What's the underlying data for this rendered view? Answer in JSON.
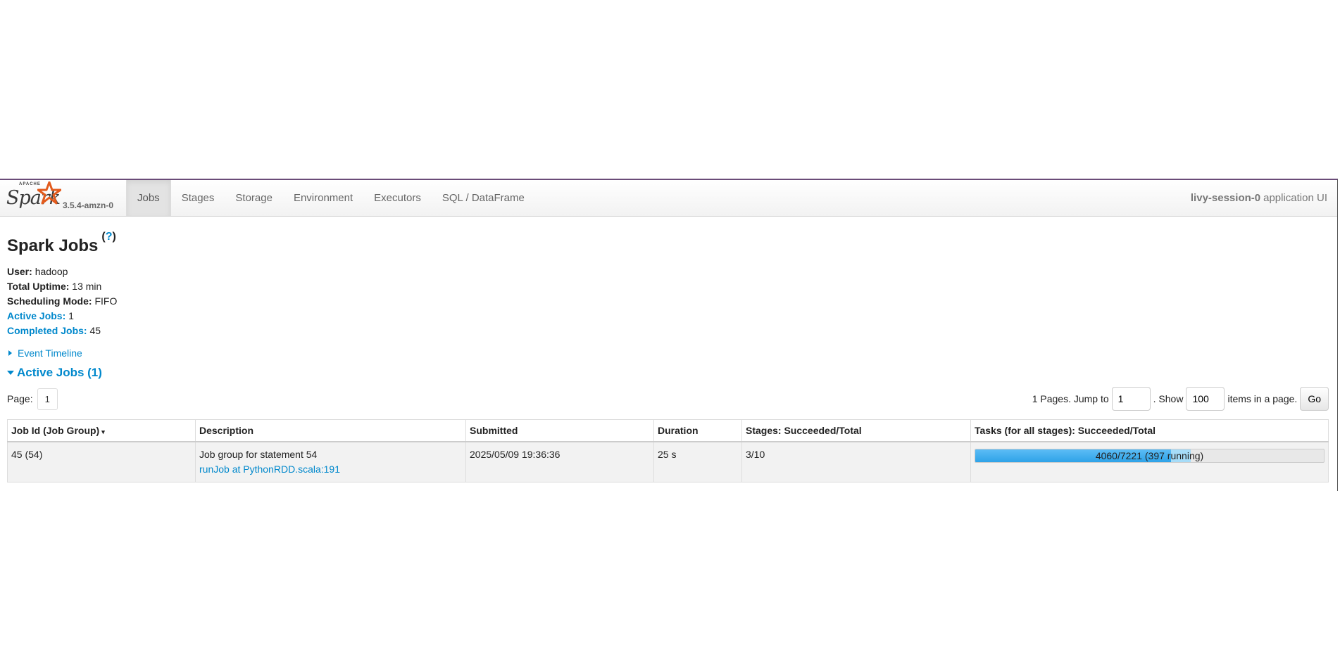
{
  "navbar": {
    "logo_apache": "APACHE",
    "logo_word": "Spark",
    "version": "3.5.4-amzn-0",
    "tabs": [
      {
        "label": "Jobs",
        "active": true
      },
      {
        "label": "Stages"
      },
      {
        "label": "Storage"
      },
      {
        "label": "Environment"
      },
      {
        "label": "Executors"
      },
      {
        "label": "SQL / DataFrame"
      }
    ],
    "app_name": "livy-session-0",
    "app_suffix": "application UI"
  },
  "page": {
    "title": "Spark Jobs",
    "help": "?"
  },
  "summary": {
    "user_label": "User:",
    "user_value": "hadoop",
    "uptime_label": "Total Uptime:",
    "uptime_value": "13 min",
    "mode_label": "Scheduling Mode:",
    "mode_value": "FIFO",
    "active_label": "Active Jobs:",
    "active_value": "1",
    "completed_label": "Completed Jobs:",
    "completed_value": "45"
  },
  "event_timeline": "Event Timeline",
  "active_jobs": {
    "heading": "Active Jobs (1)",
    "paging": {
      "page_label": "Page:",
      "page_value": "1",
      "pages_text": "1 Pages. Jump to",
      "jump_value": "1",
      "show_text": ". Show",
      "show_value": "100",
      "items_text": "items in a page.",
      "go_label": "Go"
    },
    "columns": [
      "Job Id (Job Group)",
      "Description",
      "Submitted",
      "Duration",
      "Stages: Succeeded/Total",
      "Tasks (for all stages): Succeeded/Total"
    ],
    "sort_indicator": "▾",
    "rows": [
      {
        "job_id": "45 (54)",
        "description": "Job group for statement 54",
        "description_link": "runJob at PythonRDD.scala:191",
        "submitted": "2025/05/09 19:36:36",
        "duration": "25 s",
        "stages": "3/10",
        "tasks_text": "4060/7221 (397 running)",
        "tasks_succeeded": 4060,
        "tasks_running": 397,
        "tasks_total": 7221
      }
    ]
  },
  "colors": {
    "accent": "#0088cc",
    "spark_orange": "#e25a1c",
    "progress_completed": "#2ea3e8",
    "progress_running": "#a6dcf8",
    "top_border": "#6a4b78"
  }
}
